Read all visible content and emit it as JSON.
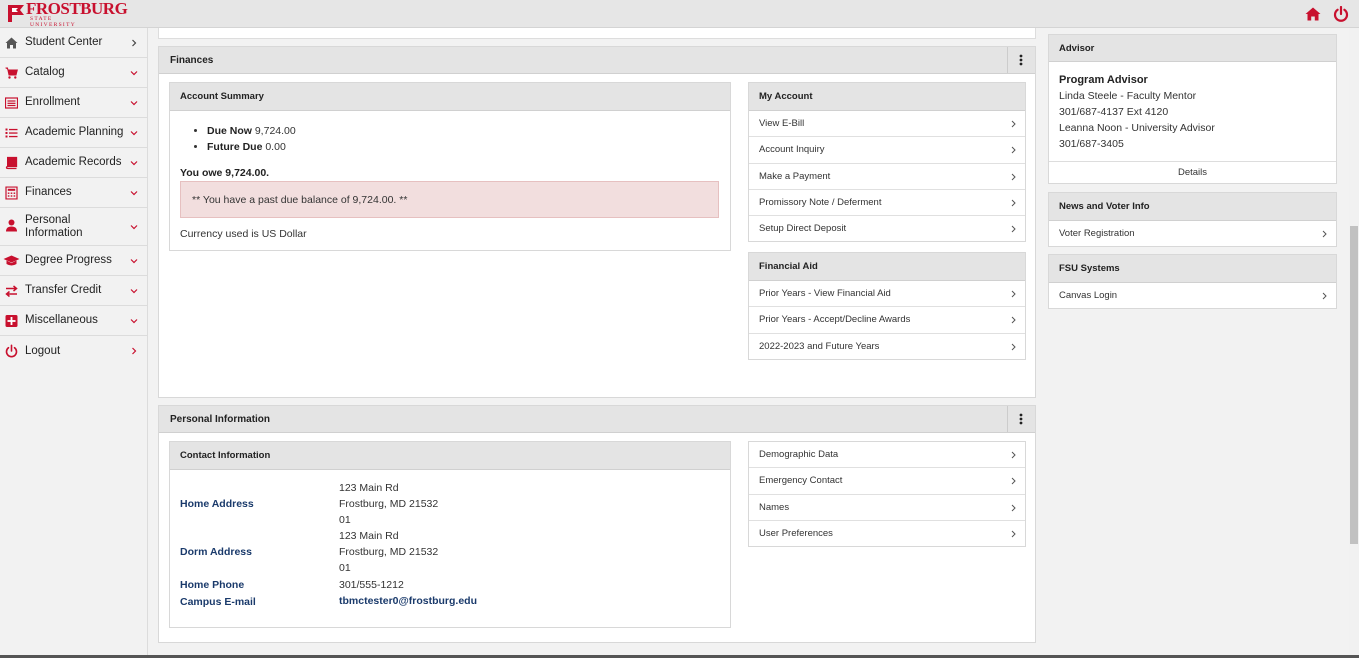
{
  "brand": {
    "name": "FROSTBURG",
    "subtitle": "STATE UNIVERSITY",
    "accent": "#c8102e",
    "link_color": "#1a3a6b"
  },
  "topbar": {
    "home_icon": "home-icon",
    "power_icon": "power-icon"
  },
  "sidebar": {
    "items": [
      {
        "label": "Student Center",
        "icon": "home-icon",
        "chevron": "right"
      },
      {
        "label": "Catalog",
        "icon": "cart-icon",
        "chevron": "down"
      },
      {
        "label": "Enrollment",
        "icon": "list-window-icon",
        "chevron": "down"
      },
      {
        "label": "Academic Planning",
        "icon": "list-icon",
        "chevron": "down"
      },
      {
        "label": "Academic Records",
        "icon": "book-icon",
        "chevron": "down"
      },
      {
        "label": "Finances",
        "icon": "calculator-icon",
        "chevron": "down"
      },
      {
        "label": "Personal Information",
        "icon": "user-icon",
        "chevron": "down"
      },
      {
        "label": "Degree Progress",
        "icon": "graduation-cap-icon",
        "chevron": "down"
      },
      {
        "label": "Transfer Credit",
        "icon": "transfer-icon",
        "chevron": "down"
      },
      {
        "label": "Miscellaneous",
        "icon": "plus-square-icon",
        "chevron": "down"
      },
      {
        "label": "Logout",
        "icon": "power-icon",
        "chevron": "right"
      }
    ]
  },
  "finances": {
    "title": "Finances",
    "account_summary": {
      "title": "Account Summary",
      "due_now_label": "Due Now",
      "due_now_value": "9,724.00",
      "future_due_label": "Future Due",
      "future_due_value": "0.00",
      "you_owe": "You owe 9,724.00.",
      "alert": "** You have a past due balance of 9,724.00. **",
      "currency": "Currency used is US Dollar"
    },
    "my_account": {
      "title": "My Account",
      "links": [
        "View E-Bill",
        "Account Inquiry",
        "Make a Payment",
        "Promissory Note / Deferment",
        "Setup Direct Deposit"
      ]
    },
    "financial_aid": {
      "title": "Financial Aid",
      "links": [
        "Prior Years - View Financial Aid",
        "Prior Years - Accept/Decline Awards",
        "2022-2023 and Future Years"
      ]
    }
  },
  "personal_information": {
    "title": "Personal Information",
    "contact": {
      "title": "Contact Information",
      "home_address_label": "Home Address",
      "home_address": [
        "123 Main Rd",
        "Frostburg, MD 21532",
        "01"
      ],
      "dorm_address_label": "Dorm Address",
      "dorm_address": [
        "123 Main Rd",
        "Frostburg, MD 21532",
        "01"
      ],
      "home_phone_label": "Home Phone",
      "home_phone": "301/555-1212",
      "email_label": "Campus E-mail",
      "email": "tbmctester0@frostburg.edu"
    },
    "links": [
      "Demographic Data",
      "Emergency Contact",
      "Names",
      "User Preferences"
    ]
  },
  "advisor": {
    "title": "Advisor",
    "heading": "Program Advisor",
    "lines": [
      "Linda Steele - Faculty Mentor",
      "301/687-4137 Ext 4120",
      "Leanna Noon - University Advisor",
      "301/687-3405"
    ],
    "details_label": "Details"
  },
  "news": {
    "title": "News and Voter Info",
    "links": [
      "Voter Registration"
    ]
  },
  "fsu_systems": {
    "title": "FSU Systems",
    "links": [
      "Canvas Login"
    ]
  }
}
